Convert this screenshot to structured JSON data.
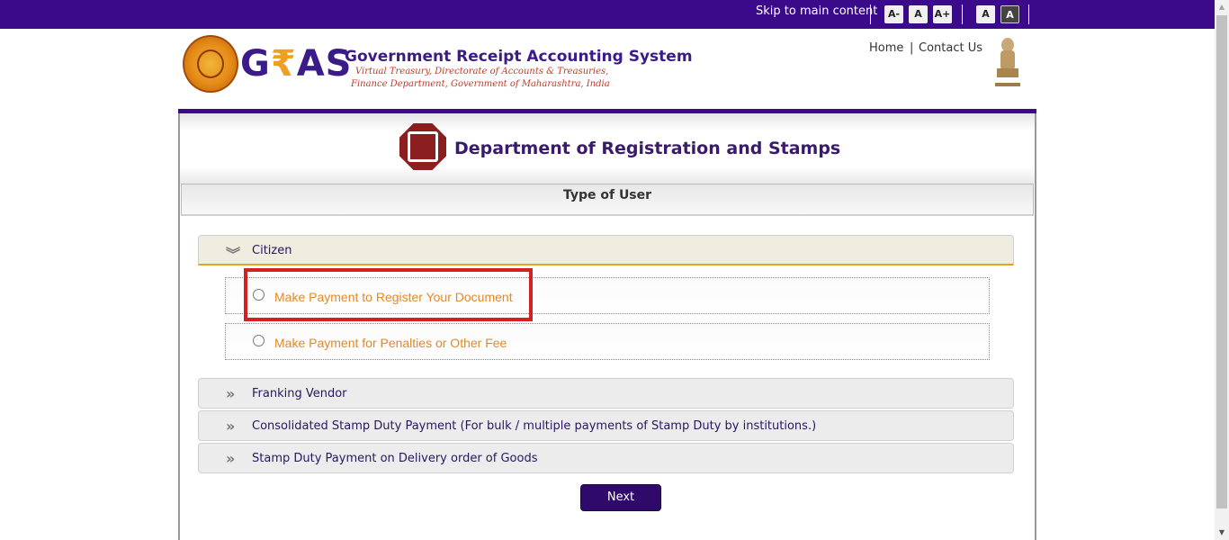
{
  "topbar": {
    "skip_label": "Skip to main content",
    "font_buttons": [
      "A-",
      "A",
      "A+"
    ],
    "contrast_buttons": [
      "A",
      "A"
    ]
  },
  "header": {
    "logo_text_prefix": "G",
    "logo_text_rupee": "₹",
    "logo_text_suffix": "AS",
    "title": "Government Receipt Accounting System",
    "subtitle_line1": "Virtual Treasury, Directorate of Accounts & Treasuries,",
    "subtitle_line2": "Finance Department, Government of Maharashtra, India",
    "links": [
      "Home",
      "Contact Us"
    ],
    "link_separator": "|"
  },
  "department": {
    "title": "Department of Registration and Stamps"
  },
  "user_type": {
    "heading": "Type of User",
    "sections": [
      {
        "label": "Citizen",
        "expanded": true,
        "icon": "double-chevron-down-icon"
      },
      {
        "label": "Franking Vendor",
        "expanded": false,
        "icon": "double-chevron-right-icon"
      },
      {
        "label": "Consolidated Stamp Duty Payment (For bulk / multiple payments of Stamp Duty by institutions.)",
        "expanded": false,
        "icon": "double-chevron-right-icon"
      },
      {
        "label": "Stamp Duty Payment on Delivery order of Goods",
        "expanded": false,
        "icon": "double-chevron-right-icon"
      }
    ],
    "citizen_options": [
      {
        "label": "Make Payment to Register Your Document",
        "selected": false
      },
      {
        "label": "Make Payment for Penalties or Other Fee",
        "selected": false
      }
    ]
  },
  "actions": {
    "next_label": "Next"
  },
  "colors": {
    "topbar": "#3a0a8a",
    "accent_orange": "#e08a2a",
    "highlight_red": "#d42020",
    "button_bg": "#2f0a6a"
  }
}
